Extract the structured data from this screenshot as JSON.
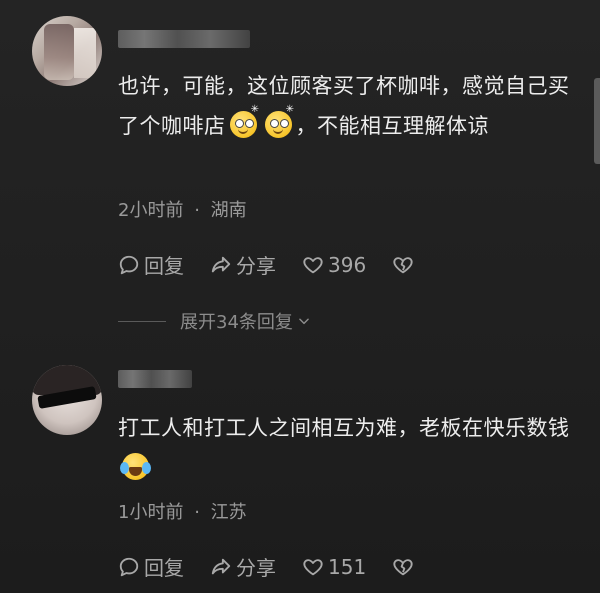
{
  "comments": [
    {
      "text_part1": "也许，可能，这位顾客买了杯咖啡，感觉自己买了个咖啡店",
      "emoji": "smiling-sparkle-emoji",
      "text_part2": "，不能相互理解体谅",
      "time": "2小时前",
      "location": "湖南",
      "reply_label": "回复",
      "share_label": "分享",
      "likes": "396",
      "expand_label": "展开34条回复"
    },
    {
      "text_part1": "打工人和打工人之间相互为难，老板在快乐数钱",
      "emoji": "crying-laughing-emoji",
      "text_part2": "",
      "time": "1小时前",
      "location": "江苏",
      "reply_label": "回复",
      "share_label": "分享",
      "likes": "151"
    }
  ],
  "meta_separator": "·",
  "colors": {
    "background": "#222222",
    "text": "#ededed",
    "muted": "#9a9a9a",
    "emoji_yellow": "#f7c52b"
  },
  "icons": {
    "reply": "comment-bubble-icon",
    "share": "share-arrow-icon",
    "like": "heart-icon",
    "dislike": "broken-heart-icon",
    "expand": "chevron-down-icon"
  }
}
